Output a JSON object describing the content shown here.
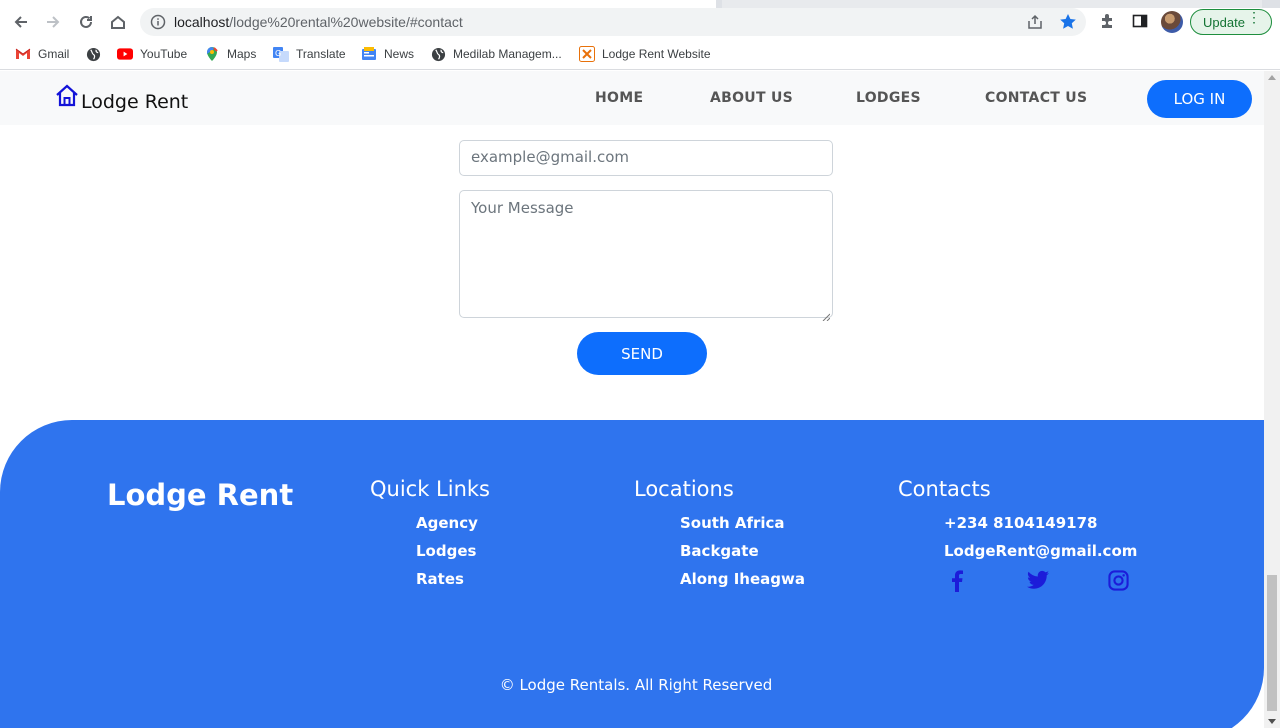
{
  "browser": {
    "url_host": "localhost",
    "url_path": "/lodge%20rental%20website/#contact",
    "update_label": "Update",
    "bookmarks": [
      {
        "label": "Gmail",
        "icon": "gmail-icon"
      },
      {
        "label": "",
        "icon": "globe-icon"
      },
      {
        "label": "YouTube",
        "icon": "youtube-icon"
      },
      {
        "label": "Maps",
        "icon": "maps-icon"
      },
      {
        "label": "Translate",
        "icon": "translate-icon"
      },
      {
        "label": "News",
        "icon": "news-icon"
      },
      {
        "label": "Medilab Managem...",
        "icon": "globe-icon"
      },
      {
        "label": "Lodge Rent Website",
        "icon": "lodge-rent-favicon"
      }
    ]
  },
  "header": {
    "brand": "Lodge Rent",
    "nav": [
      "HOME",
      "ABOUT US",
      "LODGES",
      "CONTACT US"
    ],
    "login_label": "LOG IN"
  },
  "contact_form": {
    "email_placeholder": "example@gmail.com",
    "message_placeholder": "Your Message",
    "send_label": "SEND"
  },
  "footer": {
    "brand": "Lodge Rent",
    "quick_links": {
      "title": "Quick Links",
      "items": [
        "Agency",
        "Lodges",
        "Rates"
      ]
    },
    "locations": {
      "title": "Locations",
      "items": [
        "South Africa",
        "Backgate",
        "Along Iheagwa"
      ]
    },
    "contacts": {
      "title": "Contacts",
      "phone": "+234 8104149178",
      "email": "LodgeRent@gmail.com"
    },
    "social_icons": [
      "facebook-icon",
      "twitter-icon",
      "instagram-icon"
    ],
    "copyright": "© Lodge Rentals. All Right Reserved"
  },
  "colors": {
    "primary": "#0d6efd",
    "footer_bg": "#2f74ee",
    "social_icon": "#1c1cd9",
    "header_bg": "#f8f9fa"
  }
}
